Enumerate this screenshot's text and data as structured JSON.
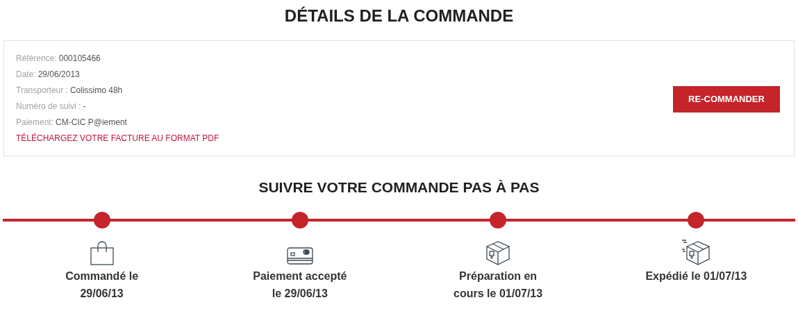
{
  "title": "DÉTAILS DE LA COMMANDE",
  "details": [
    {
      "label": "Référence:",
      "value": "000105466"
    },
    {
      "label": "Date:",
      "value": "29/06/2013"
    },
    {
      "label": "Transporteur :",
      "value": "Colissimo 48h"
    },
    {
      "label": "Numéro de suivi :",
      "value": "-"
    },
    {
      "label": "Paiement:",
      "value": "CM-CIC P@iement"
    }
  ],
  "invoice_link": "TÉLÉCHARGEZ VOTRE FACTURE AU FORMAT PDF",
  "reorder_button": "RE-COMMANDER",
  "tracking_title": "SUIVRE VOTRE COMMANDE PAS À PAS",
  "steps": [
    {
      "kind": "bag",
      "lines": [
        "Commandé le",
        "29/06/13"
      ],
      "completed": true
    },
    {
      "kind": "card",
      "lines": [
        "Paiement accepté",
        "le 29/06/13"
      ],
      "completed": true
    },
    {
      "kind": "box",
      "lines": [
        "Préparation en",
        "cours le 01/07/13"
      ],
      "completed": true
    },
    {
      "kind": "shipping",
      "lines": [
        "Expédié le 01/07/13"
      ],
      "completed": true
    }
  ]
}
